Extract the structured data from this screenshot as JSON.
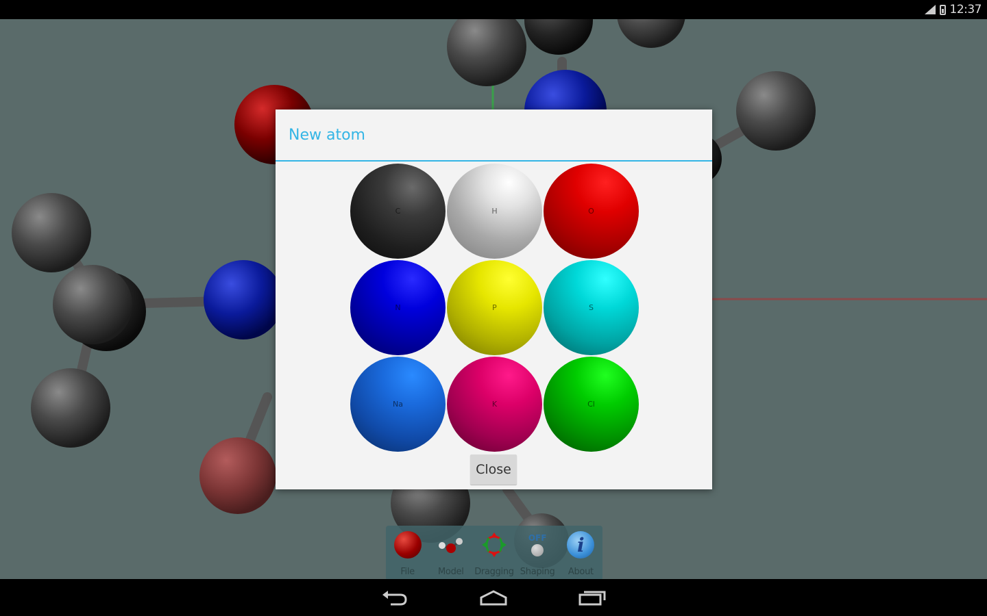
{
  "status_bar": {
    "time": "12:37"
  },
  "dialog": {
    "title": "New atom",
    "atoms": [
      {
        "symbol": "C",
        "color": "#2b2b2b"
      },
      {
        "symbol": "H",
        "color": "#e8e8e8"
      },
      {
        "symbol": "O",
        "color": "#e00000"
      },
      {
        "symbol": "N",
        "color": "#0000cc"
      },
      {
        "symbol": "P",
        "color": "#e6e600"
      },
      {
        "symbol": "S",
        "color": "#00d8d8"
      },
      {
        "symbol": "Na",
        "color": "#1e6fdc"
      },
      {
        "symbol": "K",
        "color": "#e0006c"
      },
      {
        "symbol": "Cl",
        "color": "#00c800"
      }
    ],
    "close_label": "Close"
  },
  "toolbar": {
    "file_label": "File",
    "model_label": "Model",
    "dragging_label": "Dragging",
    "shaping_label": "Shaping",
    "shaping_state": "OFF",
    "about_label": "About",
    "about_glyph": "i"
  },
  "colors": {
    "accent": "#33b5e5",
    "scene_background": "#5a6b6a",
    "dialog_background": "#f3f3f3"
  },
  "icons": [
    "signal-icon",
    "battery-icon",
    "back-icon",
    "home-icon",
    "recent-apps-icon"
  ]
}
